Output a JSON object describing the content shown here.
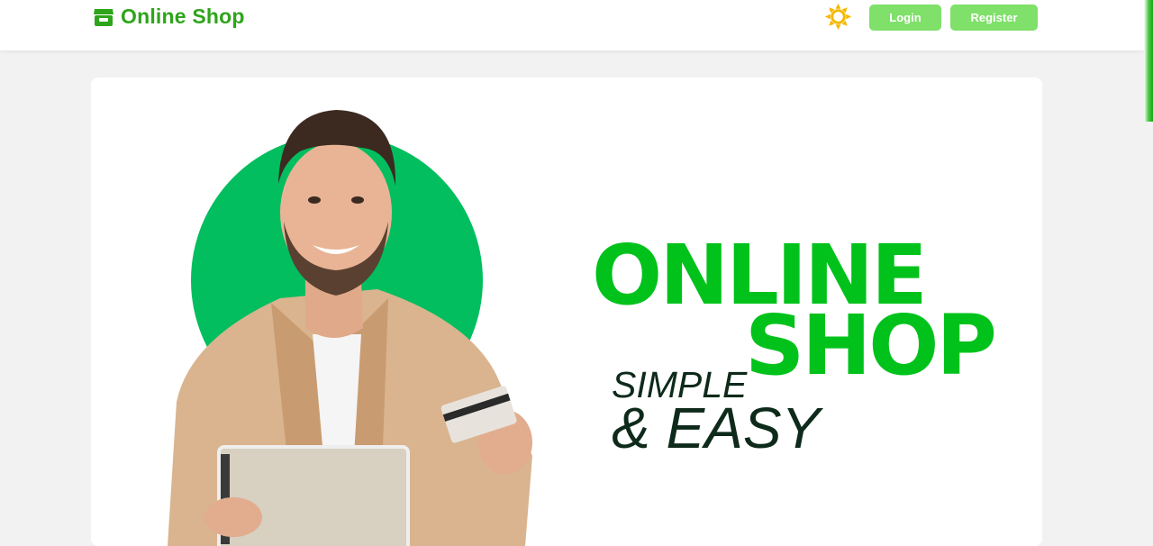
{
  "header": {
    "brand": "Online Shop",
    "brand_icon": "shop-icon",
    "theme_icon": "sun-icon",
    "login_label": "Login",
    "register_label": "Register"
  },
  "hero": {
    "title_line1": "ONLINE",
    "title_line2": "SHOP",
    "subtitle_line1": "SIMPLE",
    "subtitle_line2": "& EASY",
    "image": "man-with-tablet-and-card-photo"
  },
  "colors": {
    "brand_green": "#2ea41b",
    "button_green": "#7fe06a",
    "hero_green": "#00c21b",
    "circle_green": "#02be5f",
    "sun_yellow": "#f5b800",
    "text_dark": "#0e2a1a"
  }
}
